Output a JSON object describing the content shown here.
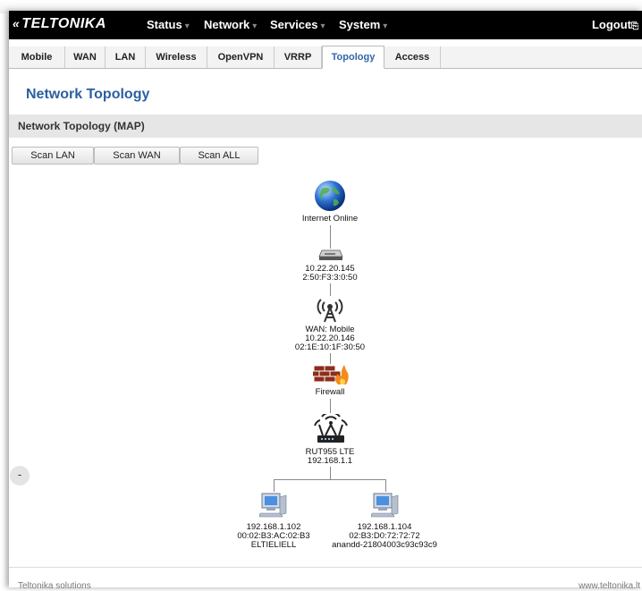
{
  "brand": "TELTONIKA",
  "menu": [
    "Status",
    "Network",
    "Services",
    "System"
  ],
  "logout": "Logout",
  "tabs": [
    "Mobile",
    "WAN",
    "LAN",
    "Wireless",
    "OpenVPN",
    "VRRP",
    "Topology",
    "Access"
  ],
  "active_tab": "Topology",
  "page_title": "Network Topology",
  "section_title": "Network Topology (MAP)",
  "buttons": {
    "scan_lan": "Scan LAN",
    "scan_wan": "Scan WAN",
    "scan_all": "Scan ALL"
  },
  "topology": {
    "internet": "Internet Online",
    "gateway": {
      "ip": "10.22.20.145",
      "mac": "2:50:F3:3:0:50"
    },
    "wan": {
      "line1": "WAN: Mobile",
      "ip": "10.22.20.146",
      "mac": "02:1E:10:1F:30:50"
    },
    "firewall": "Firewall",
    "router": {
      "name": "RUT955 LTE",
      "ip": "192.168.1.1"
    },
    "clients": [
      {
        "ip": "192.168.1.102",
        "mac": "00:02:B3:AC:02:B3",
        "name": "ELTIELIELL"
      },
      {
        "ip": "192.168.1.104",
        "mac": "02:B3:D0:72:72:72",
        "name": "anandd-21804003c93c93c9"
      }
    ]
  },
  "collapse_symbol": "-",
  "footer": {
    "left": "Teltonika solutions",
    "right": "www.teltonika.lt"
  }
}
